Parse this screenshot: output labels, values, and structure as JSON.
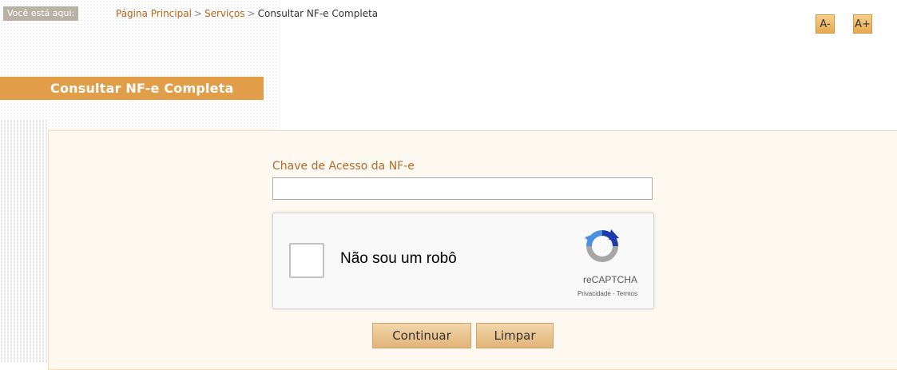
{
  "breadcrumb": {
    "label": "Você está aqui:",
    "home": "Página Principal",
    "separator": ">",
    "services": "Serviços",
    "current": "Consultar NF-e Completa"
  },
  "font_controls": {
    "decrease": "A-",
    "increase": "A+"
  },
  "page": {
    "title": "Consultar NF-e Completa"
  },
  "form": {
    "access_key_label": "Chave de Acesso da NF-e",
    "access_key_value": ""
  },
  "captcha": {
    "checkbox_label": "Não sou um robô",
    "brand": "reCAPTCHA",
    "privacy": "Privacidade",
    "link_separator": "-",
    "terms": "Termos"
  },
  "buttons": {
    "continue": "Continuar",
    "clear": "Limpar"
  },
  "colors": {
    "accent": "#e29d49",
    "link": "#b9651a",
    "button": "#e8bd86",
    "panel": "#fdf9f1"
  }
}
